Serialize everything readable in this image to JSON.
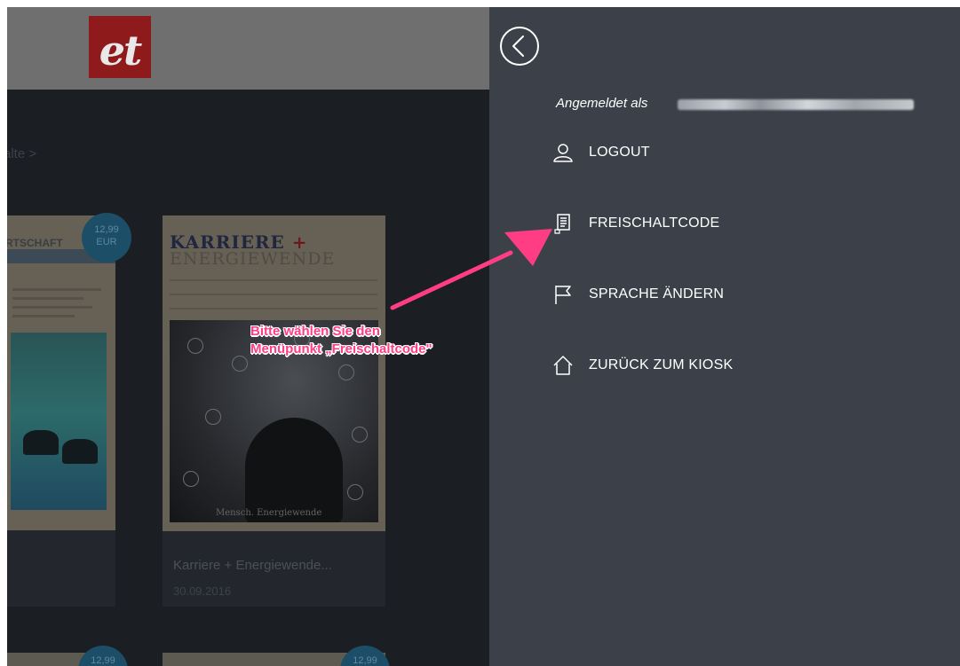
{
  "app": {
    "logo_text": "et",
    "breadcrumb_fragment": "alte >",
    "issues": [
      {
        "masthead": "RTSCHAFT",
        "price": "12,99",
        "currency": "EUR"
      },
      {
        "masthead": "KARRIERE",
        "masthead_plus": "+",
        "subtitle": "ENERGIEWENDE",
        "cover_caption": "Mensch. Energiewende",
        "title": "Karriere + Energiewende...",
        "date": "30.09.2016"
      }
    ],
    "bottom_prices": [
      "12,99",
      "12,99"
    ]
  },
  "menu": {
    "logged_in_label": "Angemeldet als",
    "items": [
      {
        "label": "LOGOUT",
        "icon": "user-icon"
      },
      {
        "label": "FREISCHALTCODE",
        "icon": "document-code-icon"
      },
      {
        "label": "SPRACHE ÄNDERN",
        "icon": "flag-icon"
      },
      {
        "label": "ZURÜCK ZUM KIOSK",
        "icon": "home-icon"
      }
    ]
  },
  "annotation": {
    "line1": "Bitte wählen Sie den",
    "line2": "Menüpunkt „Freischaltcode\"",
    "color": "#ff3d84"
  },
  "colors": {
    "menu_bg": "#3b4049",
    "app_bg": "#1b1e23",
    "header_bg": "#6f6f6f",
    "logo_bg": "#8f1a1c",
    "price_badge": "#1d4e67"
  }
}
